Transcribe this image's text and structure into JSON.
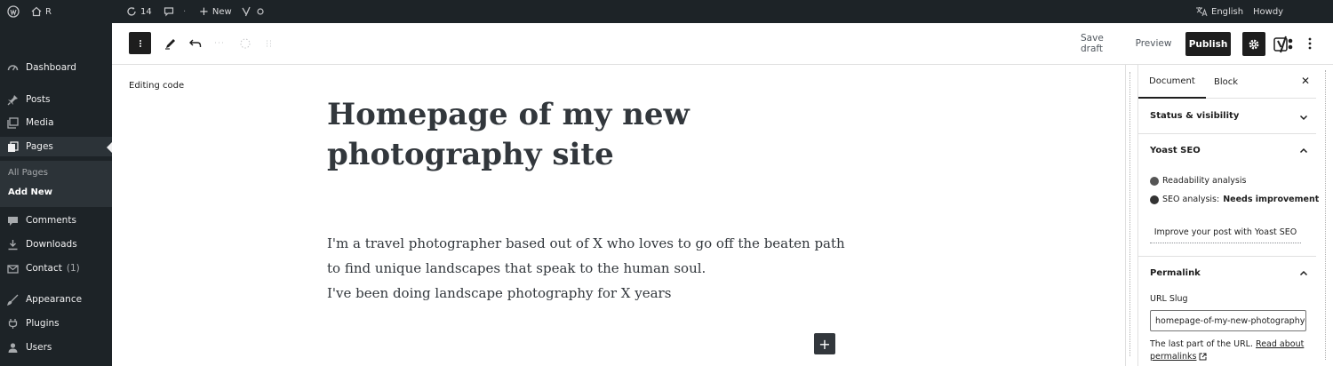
{
  "admin_bar": {
    "site_label": "R",
    "updates_count": "14",
    "new_label": "New",
    "language": "English",
    "howdy": "Howdy"
  },
  "admin_menu": {
    "items": [
      {
        "label": "Dashboard",
        "icon": "dashboard-icon"
      },
      {
        "label": "Posts",
        "icon": "pin-icon"
      },
      {
        "label": "Media",
        "icon": "media-icon"
      },
      {
        "label": "Pages",
        "icon": "pages-icon"
      },
      {
        "label": "Comments",
        "icon": "comments-icon"
      },
      {
        "label": "Downloads",
        "icon": "downloads-icon"
      },
      {
        "label": "Contact",
        "icon": "mail-icon",
        "badge": "1"
      },
      {
        "label": "Appearance",
        "icon": "appearance-icon"
      },
      {
        "label": "Plugins",
        "icon": "plugins-icon"
      },
      {
        "label": "Users",
        "icon": "users-icon"
      }
    ],
    "submenu": [
      "All Pages",
      "Add New"
    ]
  },
  "header": {
    "save_draft": "Save draft",
    "preview": "Preview",
    "publish": "Publish"
  },
  "editor": {
    "mode_label": "Editing code",
    "title_line1": "Homepage of my new",
    "title_line2": "photography site",
    "paragraph_lines": [
      "I'm a travel photographer based out of X who loves to go off the beaten path",
      "to find unique landscapes that speak to the human soul.",
      "I've been doing landscape photography for X years"
    ]
  },
  "sidebar": {
    "tabs": [
      "Document",
      "Block"
    ],
    "status_visibility": "Status & visibility",
    "yoast_title": "Yoast SEO",
    "readability": "Readability analysis",
    "seo_prefix": "SEO analysis:",
    "seo_status": "Needs improvement",
    "improve_link": "Improve your post with Yoast SEO",
    "permalink_title": "Permalink",
    "url_slug_label": "URL Slug",
    "url_slug_value": "homepage-of-my-new-photography-",
    "help_prefix": "The last part of the URL.",
    "help_link_1": "Read about",
    "help_link_2": "permalinks"
  },
  "colors": {
    "admin_dark": "#1d2327",
    "submenu": "#2c3338",
    "editor_dark": "#1e1e1e",
    "text_content": "#32373c"
  }
}
